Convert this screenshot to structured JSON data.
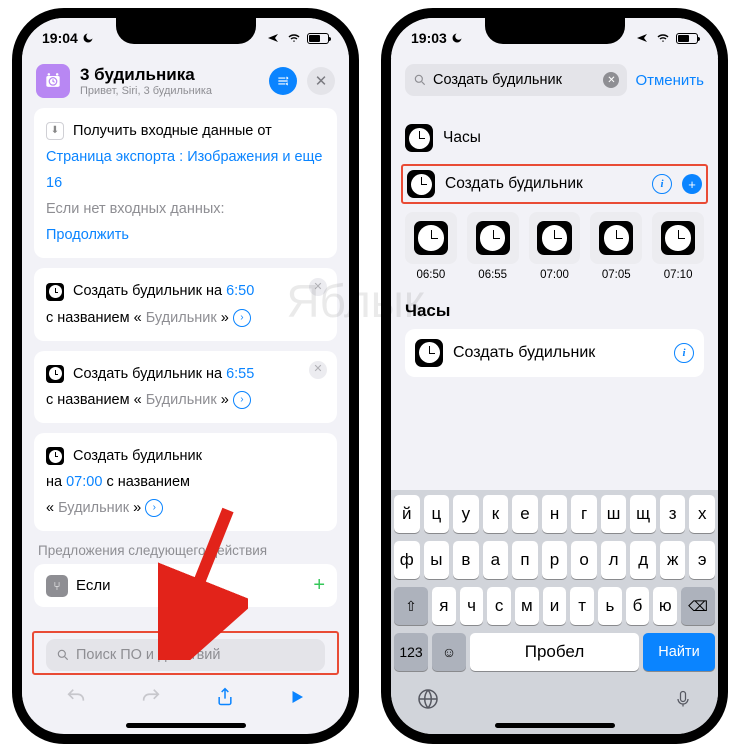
{
  "watermark": "Яблык",
  "left": {
    "status": {
      "time": "19:04"
    },
    "header": {
      "title": "3 будильника",
      "subtitle": "Привет, Siri, 3 будильника"
    },
    "input_card": {
      "line1_prefix": "Получить входные данные от",
      "source": "Страница экспорта",
      "colon": ":",
      "types": "Изображения и еще 16",
      "no_input_label": "Если нет входных данных:",
      "fallback": "Продолжить"
    },
    "alarms": [
      {
        "prefix": "Создать будильник на",
        "time": "6:50",
        "name_pre": "с названием «",
        "name": "Будильник",
        "name_post": "»"
      },
      {
        "prefix": "Создать будильник на",
        "time": "6:55",
        "name_pre": "с названием «",
        "name": "Будильник",
        "name_post": "»"
      },
      {
        "prefix": "Создать будильник",
        "time_pre": "на",
        "time": "07:00",
        "name_pre": "с названием",
        "name": "Будильник",
        "q1": "«",
        "q2": "»"
      }
    ],
    "suggest_label": "Предложения следующего действия",
    "suggest_item": "Если",
    "search_placeholder": "Поиск ПО и действий"
  },
  "right": {
    "status": {
      "time": "19:03"
    },
    "search_value": "Создать будильник",
    "cancel": "Отменить",
    "app_name": "Часы",
    "action_name": "Создать будильник",
    "thumbs": [
      "06:50",
      "06:55",
      "07:00",
      "07:05",
      "07:10"
    ],
    "section2_title": "Часы",
    "section2_item": "Создать будильник",
    "keyboard": {
      "row1": [
        "й",
        "ц",
        "у",
        "к",
        "е",
        "н",
        "г",
        "ш",
        "щ",
        "з",
        "х"
      ],
      "row2": [
        "ф",
        "ы",
        "в",
        "а",
        "п",
        "р",
        "о",
        "л",
        "д",
        "ж",
        "э"
      ],
      "row3": [
        "я",
        "ч",
        "с",
        "м",
        "и",
        "т",
        "ь",
        "б",
        "ю"
      ],
      "num": "123",
      "space": "Пробел",
      "find": "Найти"
    }
  }
}
